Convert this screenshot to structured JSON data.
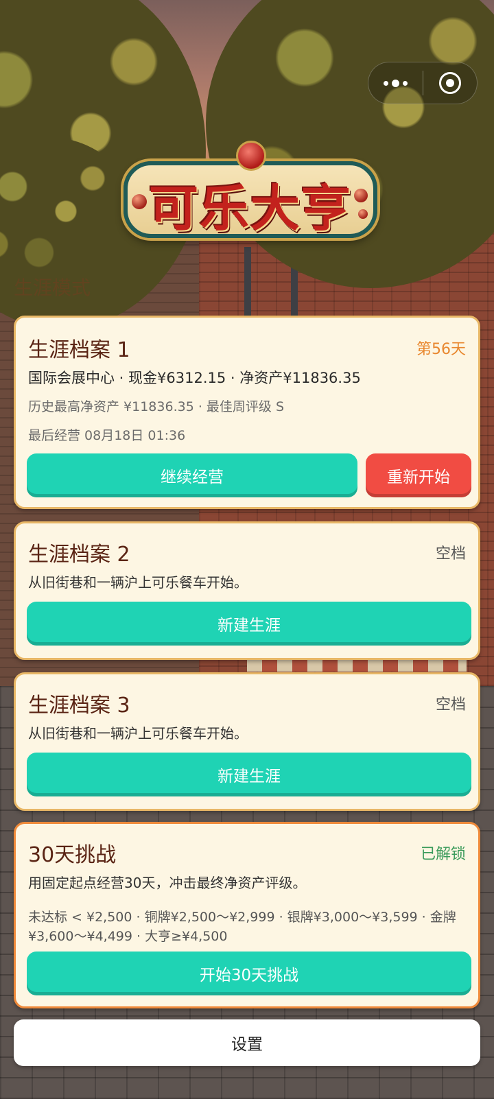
{
  "game": {
    "title": "可乐大亨",
    "mode_label": "生涯模式"
  },
  "capsule": {
    "more_icon": "more-dots-icon",
    "close_icon": "target-close-icon"
  },
  "slot1": {
    "title": "生涯档案 1",
    "tag": "第56天",
    "summary": "国际会展中心 · 现金¥6312.15 · 净资产¥11836.35",
    "history": "历史最高净资产 ¥11836.35 · 最佳周评级 S",
    "last_played": "最后经营 08月18日 01:36",
    "continue_label": "继续经营",
    "restart_label": "重新开始"
  },
  "slot2": {
    "title": "生涯档案 2",
    "tag": "空档",
    "description": "从旧街巷和一辆沪上可乐餐车开始。",
    "button_label": "新建生涯"
  },
  "slot3": {
    "title": "生涯档案 3",
    "tag": "空档",
    "description": "从旧街巷和一辆沪上可乐餐车开始。",
    "button_label": "新建生涯"
  },
  "challenge": {
    "title": "30天挑战",
    "tag": "已解锁",
    "description": "用固定起点经营30天，冲击最终净资产评级。",
    "tiers": "未达标 < ¥2,500 · 铜牌¥2,500～¥2,999 · 银牌¥3,000～¥3,599 · 金牌¥3,600～¥4,499 · 大亨≥¥4,500",
    "button_label": "开始30天挑战"
  },
  "settings_label": "设置",
  "colors": {
    "accent_green": "#1fd3b4",
    "danger_red": "#f14c43",
    "day_orange": "#e8872e",
    "unlocked_green": "#3a9a5a"
  }
}
